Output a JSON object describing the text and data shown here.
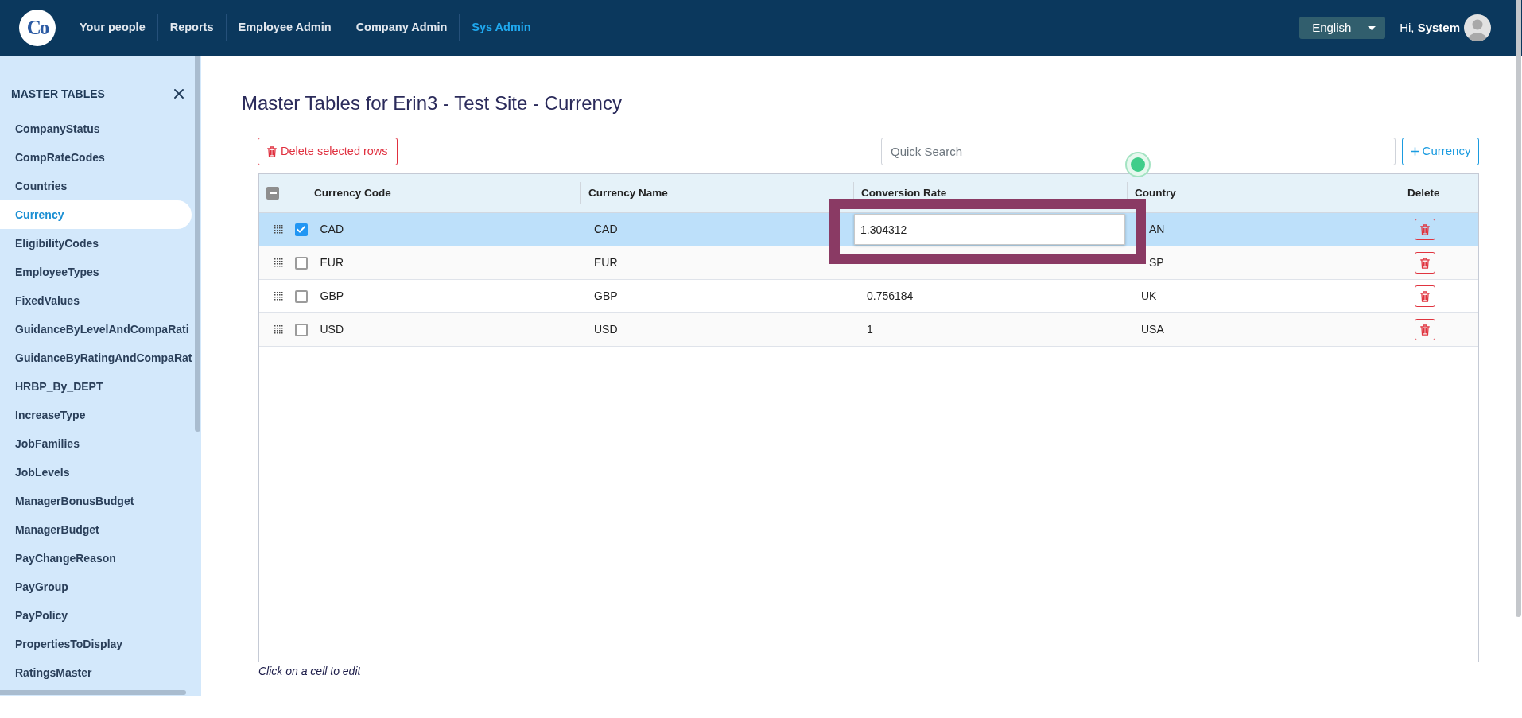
{
  "top_bar": {
    "logo": "Co",
    "nav": [
      {
        "label": "Your people",
        "selected": false
      },
      {
        "label": "Reports",
        "selected": false
      },
      {
        "label": "Employee Admin",
        "selected": false
      },
      {
        "label": "Company Admin",
        "selected": false
      },
      {
        "label": "Sys Admin",
        "selected": true
      }
    ],
    "language": "English",
    "greeting": "Hi, **System**"
  },
  "sidebar": {
    "title": "MASTER TABLES",
    "items": [
      {
        "label": "CompanyStatus",
        "selected": false
      },
      {
        "label": "CompRateCodes",
        "selected": false
      },
      {
        "label": "Countries",
        "selected": false
      },
      {
        "label": "Currency",
        "selected": true
      },
      {
        "label": "EligibilityCodes",
        "selected": false
      },
      {
        "label": "EmployeeTypes",
        "selected": false
      },
      {
        "label": "FixedValues",
        "selected": false
      },
      {
        "label": "GuidanceByLevelAndCompaRati",
        "selected": false
      },
      {
        "label": "GuidanceByRatingAndCompaRat",
        "selected": false
      },
      {
        "label": "HRBP_By_DEPT",
        "selected": false
      },
      {
        "label": "IncreaseType",
        "selected": false
      },
      {
        "label": "JobFamilies",
        "selected": false
      },
      {
        "label": "JobLevels",
        "selected": false
      },
      {
        "label": "ManagerBonusBudget",
        "selected": false
      },
      {
        "label": "ManagerBudget",
        "selected": false
      },
      {
        "label": "PayChangeReason",
        "selected": false
      },
      {
        "label": "PayGroup",
        "selected": false
      },
      {
        "label": "PayPolicy",
        "selected": false
      },
      {
        "label": "PropertiesToDisplay",
        "selected": false
      },
      {
        "label": "RatingsMaster",
        "selected": false
      }
    ]
  },
  "page_title": "Master Tables for Erin3 - Test Site - Currency",
  "toolbar": {
    "delete_button": "Delete selected rows",
    "search": {
      "placeholder": "Quick Search"
    },
    "add_button": "Currency"
  },
  "table": {
    "select_all": {
      "indeterminate": true
    },
    "columns": [
      "Currency Code",
      "Currency Name",
      "Conversion Rate",
      "Country",
      "Delete"
    ],
    "rows": [
      {
        "code": "CAD",
        "name": "CAD",
        "rate": "1.304312",
        "country": "AN",
        "checked": true,
        "selected": true,
        "editing": true
      },
      {
        "code": "EUR",
        "name": "EUR",
        "country": "SP",
        "checked": false,
        "selected": false,
        "editing": false
      },
      {
        "code": "GBP",
        "name": "GBP",
        "rate": "0.756184",
        "country": "UK",
        "checked": false,
        "selected": false,
        "editing": false
      },
      {
        "code": "USD",
        "name": "USD",
        "rate": "1",
        "country": "USA",
        "checked": false,
        "selected": false,
        "editing": false
      }
    ]
  },
  "hint": "Click on a cell to edit"
}
